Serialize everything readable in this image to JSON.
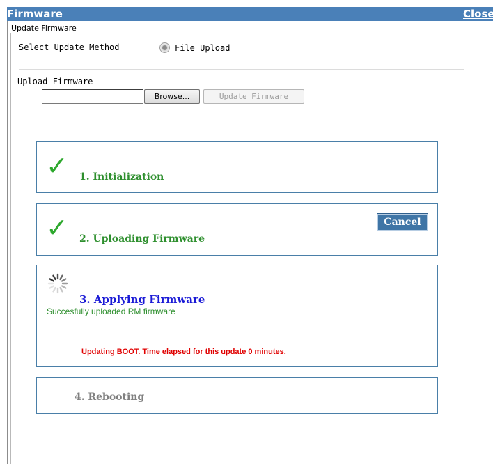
{
  "window": {
    "title": "Firmware",
    "close_label": "Close"
  },
  "fieldset": {
    "legend": "Update Firmware"
  },
  "method": {
    "label": "Select Update Method",
    "option": "File Upload"
  },
  "upload": {
    "label": "Upload Firmware",
    "file_value": "",
    "browse_label": "Browse...",
    "update_label": "Update Firmware"
  },
  "steps": [
    {
      "label": "1. Initialization",
      "status": "done",
      "icon": "check-icon"
    },
    {
      "label": "2. Uploading Firmware",
      "status": "done",
      "icon": "check-icon",
      "cancel_label": "Cancel"
    },
    {
      "label": "3. Applying Firmware",
      "status": "active",
      "icon": "spinner-icon",
      "message": "Succesfully uploaded RM firmware",
      "detail": "Updating BOOT. Time elapsed for this update 0 minutes."
    },
    {
      "label": "4. Rebooting",
      "status": "pending"
    }
  ],
  "colors": {
    "titlebar": "#4a80b8",
    "done": "#2e8f2e",
    "active": "#1a1ad6",
    "pending": "#808080",
    "error": "#e00000",
    "box_border": "#4a7fa8"
  }
}
